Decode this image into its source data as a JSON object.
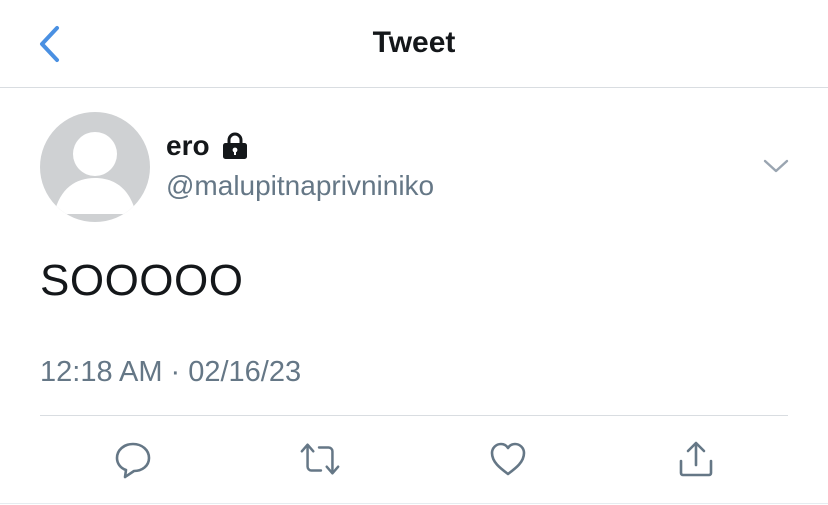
{
  "header": {
    "title": "Tweet",
    "back_icon": "chevron-left-icon",
    "accent_color": "#4a90e2"
  },
  "tweet": {
    "author": {
      "display_name": "ero",
      "handle": "@malupitnaprivniniko",
      "protected_icon": "lock-icon"
    },
    "text": "SOOOOO",
    "time": "12:18 AM",
    "separator": "·",
    "date": "02/16/23"
  },
  "actions": [
    {
      "icon": "reply-icon"
    },
    {
      "icon": "retweet-icon"
    },
    {
      "icon": "like-icon"
    },
    {
      "icon": "share-icon"
    }
  ],
  "colors": {
    "text": "#14171a",
    "secondary_text": "#657786",
    "divider": "#d9dde1",
    "avatar_bg": "#cfd1d3"
  }
}
